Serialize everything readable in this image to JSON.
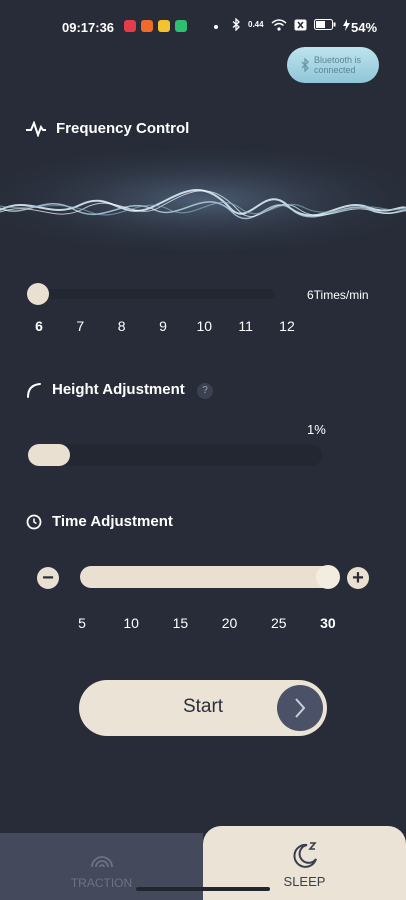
{
  "status_bar": {
    "time": "09:17:36",
    "network_speed": "0.44",
    "battery_percent": "54%",
    "app_icon_colors": [
      "#e63b4b",
      "#f06a2a",
      "#f5c22f",
      "#2fbf71"
    ]
  },
  "bluetooth": {
    "icon": "bluetooth-icon",
    "label": "Bluetooth is connected"
  },
  "frequency": {
    "title": "Frequency Control",
    "icon": "pulse-icon",
    "value_label": "6Times/min",
    "ticks": [
      "6",
      "7",
      "8",
      "9",
      "10",
      "11",
      "12"
    ],
    "selected": 6
  },
  "height": {
    "title": "Height Adjustment",
    "icon": "arc-icon",
    "help_label": "?",
    "value_label": "1%",
    "fraction": 0.01
  },
  "time": {
    "title": "Time Adjustment",
    "icon": "clock-icon",
    "minus_label": "−",
    "plus_label": "+",
    "ticks": [
      "5",
      "10",
      "15",
      "20",
      "25",
      "30"
    ],
    "selected": "30"
  },
  "start_button": {
    "label": "Start",
    "icon": "chevron-right-icon"
  },
  "bottom_nav": {
    "tabs": [
      {
        "label": "TRACTION",
        "icon": "traction-icon",
        "active": false
      },
      {
        "label": "SLEEP",
        "icon": "sleep-moon-icon",
        "active": true
      }
    ]
  },
  "colors": {
    "background": "#272c38",
    "accent": "#eae3d6",
    "track": "#232732",
    "bluetooth_pill": "#a9d6e6"
  }
}
